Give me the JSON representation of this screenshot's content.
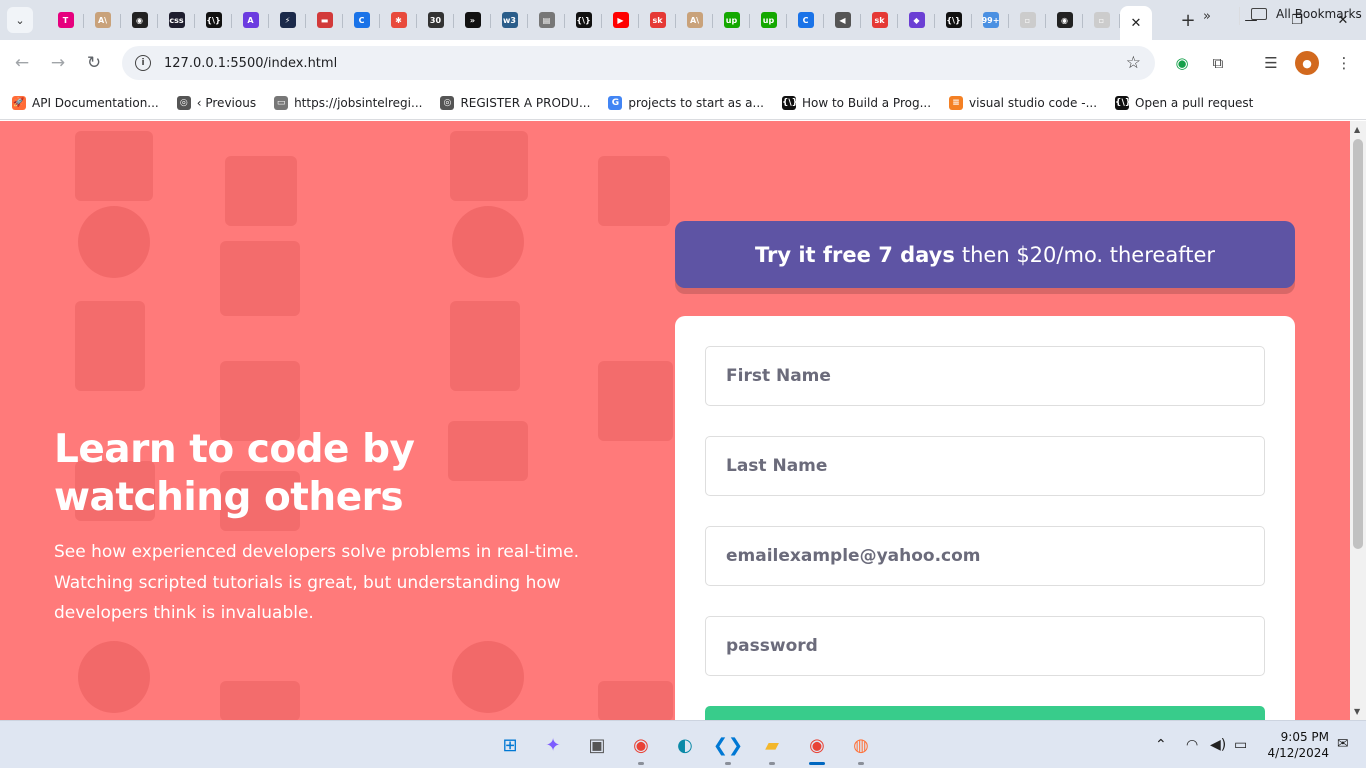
{
  "browser": {
    "tab_menu_icon": "chevron-down-icon",
    "tab_favicons": [
      {
        "name": "t-icon",
        "glyph": "T",
        "color": "#e6007e"
      },
      {
        "name": "anthropic-icon",
        "glyph": "A\\",
        "color": "#c9a27a"
      },
      {
        "name": "github-icon",
        "glyph": "◉",
        "color": "#222222"
      },
      {
        "name": "css-icon",
        "glyph": "css",
        "color": "#1e1e2e"
      },
      {
        "name": "code-icon",
        "glyph": "{\\}",
        "color": "#111111"
      },
      {
        "name": "a-purple-icon",
        "glyph": "A",
        "color": "#6c3ce0"
      },
      {
        "name": "bolt-icon",
        "glyph": "⚡",
        "color": "#1b2a4a"
      },
      {
        "name": "hat-icon",
        "glyph": "▬",
        "color": "#d23a3a"
      },
      {
        "name": "c-blue-icon",
        "glyph": "C",
        "color": "#1a73e8"
      },
      {
        "name": "asterisk-icon",
        "glyph": "✱",
        "color": "#e84a3c"
      },
      {
        "name": "calendar-icon",
        "glyph": "30",
        "color": "#333333"
      },
      {
        "name": "chevrons-icon",
        "glyph": "»",
        "color": "#111111"
      },
      {
        "name": "w3-icon",
        "glyph": "w3",
        "color": "#2a5d8a"
      },
      {
        "name": "doc-icon",
        "glyph": "▤",
        "color": "#777777"
      },
      {
        "name": "code-icon-2",
        "glyph": "{\\}",
        "color": "#111111"
      },
      {
        "name": "youtube-icon",
        "glyph": "▶",
        "color": "#ff0000"
      },
      {
        "name": "sk-icon",
        "glyph": "sk",
        "color": "#e53935"
      },
      {
        "name": "anthropic-icon-2",
        "glyph": "A\\",
        "color": "#c9a27a"
      },
      {
        "name": "upwork-icon",
        "glyph": "up",
        "color": "#14a800"
      },
      {
        "name": "upwork-icon-2",
        "glyph": "up",
        "color": "#14a800"
      },
      {
        "name": "c-blue-icon-2",
        "glyph": "C",
        "color": "#1a73e8"
      },
      {
        "name": "speaker-icon",
        "glyph": "◀",
        "color": "#555555"
      },
      {
        "name": "sk-icon-2",
        "glyph": "sk",
        "color": "#e53935"
      },
      {
        "name": "tag-icon",
        "glyph": "◆",
        "color": "#6b3fd4"
      },
      {
        "name": "code-icon-3",
        "glyph": "{\\}",
        "color": "#111111"
      },
      {
        "name": "badge-99-icon",
        "glyph": "99+",
        "color": "#4a90e2"
      },
      {
        "name": "page-icon",
        "glyph": "▫",
        "color": "#cccccc"
      },
      {
        "name": "github-icon-2",
        "glyph": "◉",
        "color": "#222222"
      },
      {
        "name": "page-icon-2",
        "glyph": "▫",
        "color": "#cccccc"
      }
    ],
    "active_tab_close": "✕",
    "new_tab": "+",
    "window_controls": {
      "minimize": "—",
      "maximize": "❐",
      "close": "✕"
    },
    "url": "127.0.0.1:5500/index.html",
    "bookmarks": [
      {
        "label": "API Documentation...",
        "icon_color": "#ff6c37",
        "glyph": "🚀"
      },
      {
        "label": "‹ Previous",
        "icon_color": "#555555",
        "glyph": "◎"
      },
      {
        "label": "https://jobsintelregi...",
        "icon_color": "#777777",
        "glyph": "▭"
      },
      {
        "label": "REGISTER A PRODU...",
        "icon_color": "#555555",
        "glyph": "◎"
      },
      {
        "label": "projects to start as a...",
        "icon_color": "#4285f4",
        "glyph": "G"
      },
      {
        "label": "How to Build a Prog...",
        "icon_color": "#111111",
        "glyph": "{\\}"
      },
      {
        "label": "visual studio code -...",
        "icon_color": "#f48024",
        "glyph": "≡"
      },
      {
        "label": "Open a pull request",
        "icon_color": "#111111",
        "glyph": "{\\}"
      }
    ],
    "bookmarks_more": "»",
    "all_bookmarks": "All Bookmarks"
  },
  "page": {
    "background_color": "#ff7a7a",
    "hero": {
      "title": "Learn to code by watching others",
      "text": "See how experienced developers solve problems in real-time. Watching scripted tutorials is great, but understanding how developers think is invaluable."
    },
    "offer": {
      "bold": "Try it free 7 days",
      "rest": "then $20/mo. thereafter",
      "color": "#5e54a4"
    },
    "form": {
      "first_name_placeholder": "First Name",
      "last_name_placeholder": "Last Name",
      "email_placeholder": "emailexample@yahoo.com",
      "password_placeholder": "password",
      "submit_color": "#38cc8b"
    }
  },
  "taskbar": {
    "apps": [
      {
        "name": "start-icon",
        "glyph": "⊞",
        "color": "#0078d4"
      },
      {
        "name": "copilot-icon",
        "glyph": "✦",
        "color": "#7c5cff"
      },
      {
        "name": "task-view-icon",
        "glyph": "▣",
        "color": "#555555"
      },
      {
        "name": "chrome-icon",
        "glyph": "◉",
        "color": "#e94235"
      },
      {
        "name": "edge-icon",
        "glyph": "◐",
        "color": "#0c8aa8"
      },
      {
        "name": "vscode-icon",
        "glyph": "❮❯",
        "color": "#0078d4"
      },
      {
        "name": "file-explorer-icon",
        "glyph": "▰",
        "color": "#f3b72c"
      },
      {
        "name": "chrome-profile-icon",
        "glyph": "◉",
        "color": "#e94235"
      },
      {
        "name": "firefox-icon",
        "glyph": "◍",
        "color": "#ff7139"
      }
    ],
    "time": "9:05 PM",
    "date": "4/12/2024"
  }
}
